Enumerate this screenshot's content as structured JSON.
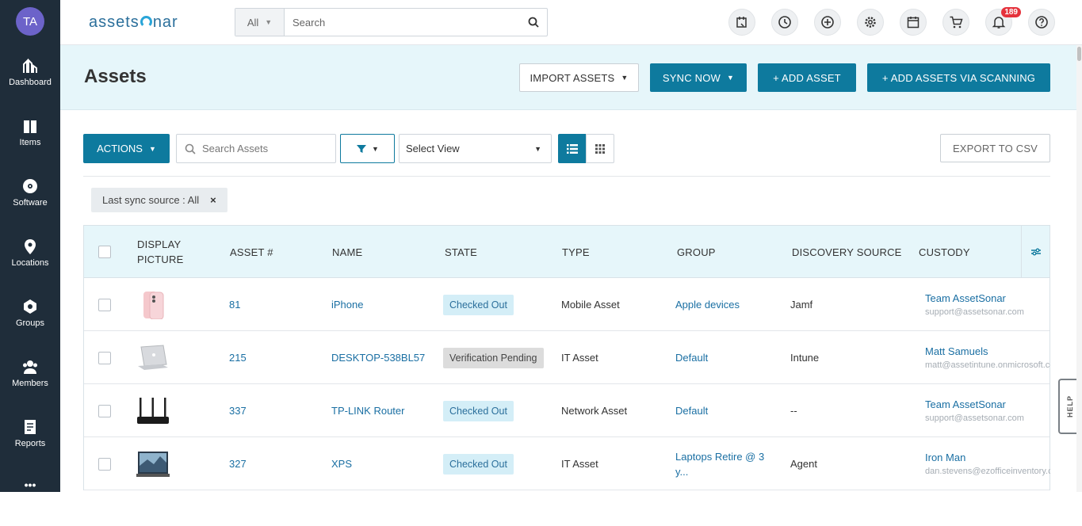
{
  "user": {
    "initials": "TA"
  },
  "sidebar": {
    "items": [
      {
        "label": "Dashboard"
      },
      {
        "label": "Items"
      },
      {
        "label": "Software"
      },
      {
        "label": "Locations"
      },
      {
        "label": "Groups"
      },
      {
        "label": "Members"
      },
      {
        "label": "Reports"
      }
    ],
    "more": "•••"
  },
  "header": {
    "logo_left": "assets",
    "logo_right": "nar",
    "search_scope": "All",
    "search_placeholder": "Search",
    "notification_count": "189"
  },
  "page": {
    "title": "Assets",
    "import_label": "IMPORT ASSETS",
    "sync_label": "SYNC NOW",
    "add_asset_label": "+ ADD ASSET",
    "add_scan_label": "+ ADD ASSETS VIA SCANNING"
  },
  "toolbar": {
    "actions_label": "ACTIONS",
    "search_placeholder": "Search Assets",
    "select_view": "Select View",
    "export_label": "EXPORT TO CSV"
  },
  "filter_chip": {
    "label": "Last sync source : All",
    "remove": "×"
  },
  "table": {
    "columns": [
      "DISPLAY PICTURE",
      "ASSET #",
      "NAME",
      "STATE",
      "TYPE",
      "GROUP",
      "DISCOVERY SOURCE",
      "CUSTODY"
    ],
    "rows": [
      {
        "asset_no": "81",
        "name": "iPhone",
        "state": "Checked Out",
        "type": "Mobile Asset",
        "group": "Apple devices",
        "group2": "",
        "source": "Jamf",
        "custody_name": "Team AssetSonar",
        "custody_email": "support@assetsonar.com"
      },
      {
        "asset_no": "215",
        "name": "DESKTOP-538BL57",
        "state": "Verification Pending",
        "type": "IT Asset",
        "group": "Default",
        "group2": "",
        "source": "Intune",
        "custody_name": "Matt Samuels",
        "custody_email": "matt@assetintune.onmicrosoft.com"
      },
      {
        "asset_no": "337",
        "name": "TP-LINK Router",
        "state": "Checked Out",
        "type": "Network Asset",
        "group": "Default",
        "group2": "",
        "source": "--",
        "custody_name": "Team AssetSonar",
        "custody_email": "support@assetsonar.com"
      },
      {
        "asset_no": "327",
        "name": "XPS",
        "state": "Checked Out",
        "type": "IT Asset",
        "group": "Laptops Retire @ 3",
        "group2": "y...",
        "source": "Agent",
        "custody_name": "Iron Man",
        "custody_email": "dan.stevens@ezofficeinventory.com"
      }
    ]
  },
  "help_tab": "HELP",
  "colors": {
    "sidebar": "#1f2d3a",
    "primary": "#0e7a9e",
    "header_bg": "#e6f6fa",
    "badge": "#e5323c"
  }
}
